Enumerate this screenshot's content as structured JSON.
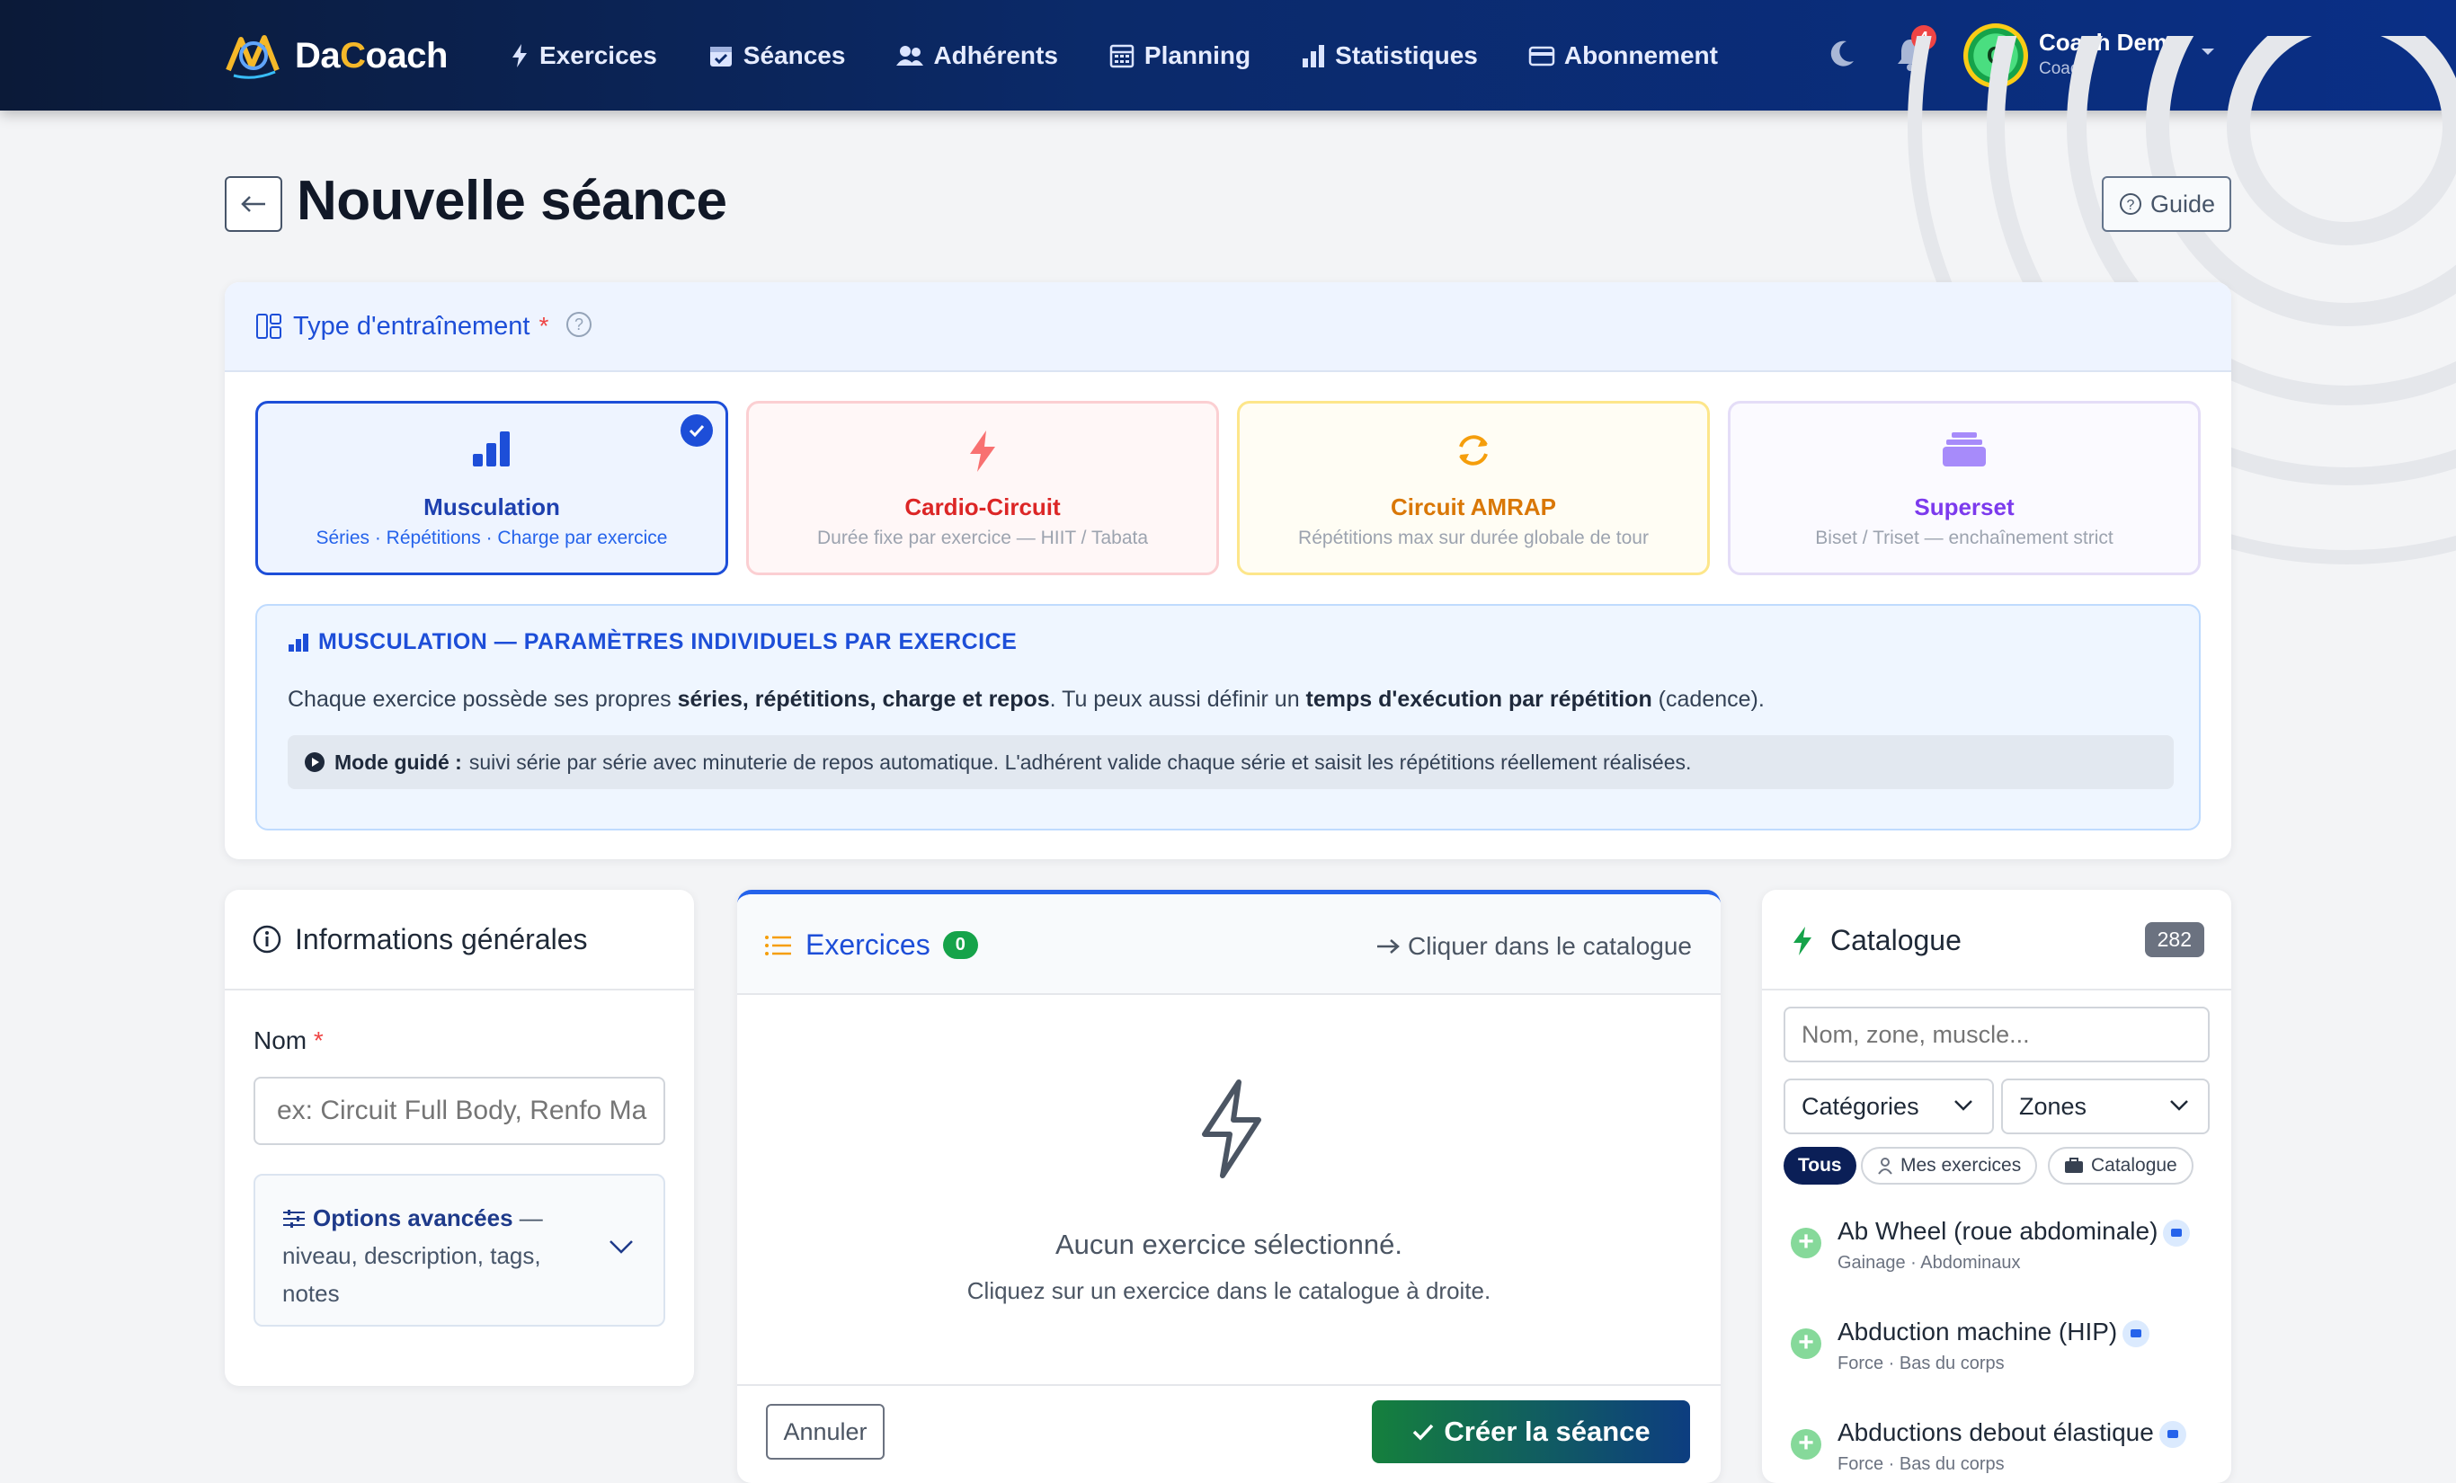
{
  "brand": {
    "name": "DaCoach"
  },
  "nav": {
    "items": [
      {
        "label": "Exercices",
        "icon": "bolt-icon"
      },
      {
        "label": "Séances",
        "icon": "calendar-check-icon"
      },
      {
        "label": "Adhérents",
        "icon": "users-icon"
      },
      {
        "label": "Planning",
        "icon": "calendar-grid-icon"
      },
      {
        "label": "Statistiques",
        "icon": "bar-chart-icon"
      },
      {
        "label": "Abonnement",
        "icon": "card-icon"
      }
    ],
    "notifications": "4",
    "user": {
      "initial": "C",
      "name": "Coach Demo",
      "role": "Coach"
    }
  },
  "page": {
    "title": "Nouvelle séance",
    "guide_label": "Guide"
  },
  "type_section": {
    "label": "Type d'entraînement",
    "required_mark": "*",
    "options": [
      {
        "title": "Musculation",
        "subtitle": "Séries · Répétitions · Charge par exercice",
        "selected": true,
        "color": "#1d4ed8"
      },
      {
        "title": "Cardio-Circuit",
        "subtitle": "Durée fixe par exercice — HIIT / Tabata",
        "selected": false,
        "color": "#dc2626"
      },
      {
        "title": "Circuit AMRAP",
        "subtitle": "Répétitions max sur durée globale de tour",
        "selected": false,
        "color": "#d97706"
      },
      {
        "title": "Superset",
        "subtitle": "Biset / Triset — enchaînement strict",
        "selected": false,
        "color": "#7c3aed"
      }
    ],
    "info": {
      "title": "MUSCULATION — PARAMÈTRES INDIVIDUELS PAR EXERCICE",
      "text_a": "Chaque exercice possède ses propres ",
      "text_b": "séries, répétitions, charge et repos",
      "text_c": ". Tu peux aussi définir un ",
      "text_d": "temps d'exécution par répétition",
      "text_e": " (cadence).",
      "guided_label": "Mode guidé :",
      "guided_text": "suivi série par série avec minuterie de repos automatique. L'adhérent valide chaque série et saisit les répétitions réellement réalisées."
    }
  },
  "general": {
    "title": "Informations générales",
    "name_label": "Nom",
    "required_mark": "*",
    "name_placeholder": "ex: Circuit Full Body, Renfo Ma",
    "advanced_label": "Options avancées",
    "advanced_desc": " — niveau, description, tags, notes"
  },
  "exercises": {
    "title": "Exercices",
    "count": "0",
    "hint": "Cliquer dans le catalogue",
    "empty_title": "Aucun exercice sélectionné.",
    "empty_sub": "Cliquez sur un exercice dans le catalogue à droite.",
    "cancel_label": "Annuler",
    "create_label": "Créer la séance"
  },
  "catalogue": {
    "title": "Catalogue",
    "count": "282",
    "search_placeholder": "Nom, zone, muscle...",
    "categories_label": "Catégories",
    "zones_label": "Zones",
    "chips": [
      "Tous",
      "Mes exercices",
      "Catalogue"
    ],
    "items": [
      {
        "name": "Ab Wheel (roue abdominale)",
        "meta": "Gainage · Abdominaux"
      },
      {
        "name": "Abduction machine (HIP)",
        "meta": "Force · Bas du corps"
      },
      {
        "name": "Abductions debout élastique",
        "meta": "Force · Bas du corps"
      }
    ]
  }
}
